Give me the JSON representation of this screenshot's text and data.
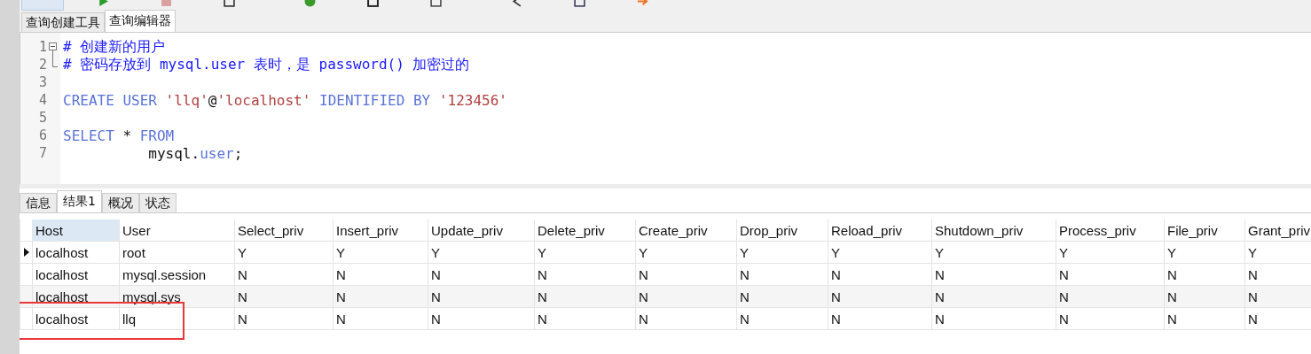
{
  "editor_tabs": [
    {
      "label": "查询创建工具",
      "selected": false
    },
    {
      "label": "查询编辑器",
      "selected": true
    }
  ],
  "editor": {
    "lines": [
      {
        "number": "1",
        "kind": "fold_start",
        "tokens": [
          {
            "kind": "comment",
            "text": "# 创建新的用户"
          }
        ]
      },
      {
        "number": "2",
        "kind": "fold_end",
        "tokens": [
          {
            "kind": "comment",
            "text": "# 密码存放到 mysql.user 表时，是 password() 加密过的"
          }
        ]
      },
      {
        "number": "3"
      },
      {
        "number": "4",
        "tokens": [
          {
            "kind": "keyword",
            "text": "CREATE USER "
          },
          {
            "kind": "string",
            "text": "'llq'"
          },
          {
            "kind": "plain",
            "text": "@"
          },
          {
            "kind": "string",
            "text": "'localhost'"
          },
          {
            "kind": "keyword",
            "text": " IDENTIFIED BY "
          },
          {
            "kind": "string",
            "text": "'123456'"
          }
        ]
      },
      {
        "number": "5"
      },
      {
        "number": "6",
        "tokens": [
          {
            "kind": "keyword",
            "text": "SELECT"
          },
          {
            "kind": "plain",
            "text": " * "
          },
          {
            "kind": "keyword",
            "text": "FROM"
          }
        ]
      },
      {
        "number": "7",
        "tokens": [
          {
            "kind": "plain",
            "text": "          mysql."
          },
          {
            "kind": "keyword",
            "text": "user"
          },
          {
            "kind": "plain",
            "text": ";"
          }
        ]
      }
    ]
  },
  "result_tabs": [
    {
      "label": "信息",
      "selected": false
    },
    {
      "label": "结果1",
      "selected": true
    },
    {
      "label": "概况",
      "selected": false
    },
    {
      "label": "状态",
      "selected": false
    }
  ],
  "table": {
    "columns": [
      "Host",
      "User",
      "Select_priv",
      "Insert_priv",
      "Update_priv",
      "Delete_priv",
      "Create_priv",
      "Drop_priv",
      "Reload_priv",
      "Shutdown_priv",
      "Process_priv",
      "File_priv",
      "Grant_priv"
    ],
    "rows": [
      {
        "current": true,
        "highlighted": false,
        "cells": [
          "localhost",
          "root",
          "Y",
          "Y",
          "Y",
          "Y",
          "Y",
          "Y",
          "Y",
          "Y",
          "Y",
          "Y",
          "Y"
        ]
      },
      {
        "current": false,
        "highlighted": false,
        "cells": [
          "localhost",
          "mysql.session",
          "N",
          "N",
          "N",
          "N",
          "N",
          "N",
          "N",
          "N",
          "N",
          "N",
          "N"
        ]
      },
      {
        "current": false,
        "highlighted": false,
        "cells": [
          "localhost",
          "mysql.sys",
          "N",
          "N",
          "N",
          "N",
          "N",
          "N",
          "N",
          "N",
          "N",
          "N",
          "N"
        ]
      },
      {
        "current": false,
        "highlighted": true,
        "cells": [
          "localhost",
          "llq",
          "N",
          "N",
          "N",
          "N",
          "N",
          "N",
          "N",
          "N",
          "N",
          "N",
          "N"
        ]
      }
    ]
  }
}
